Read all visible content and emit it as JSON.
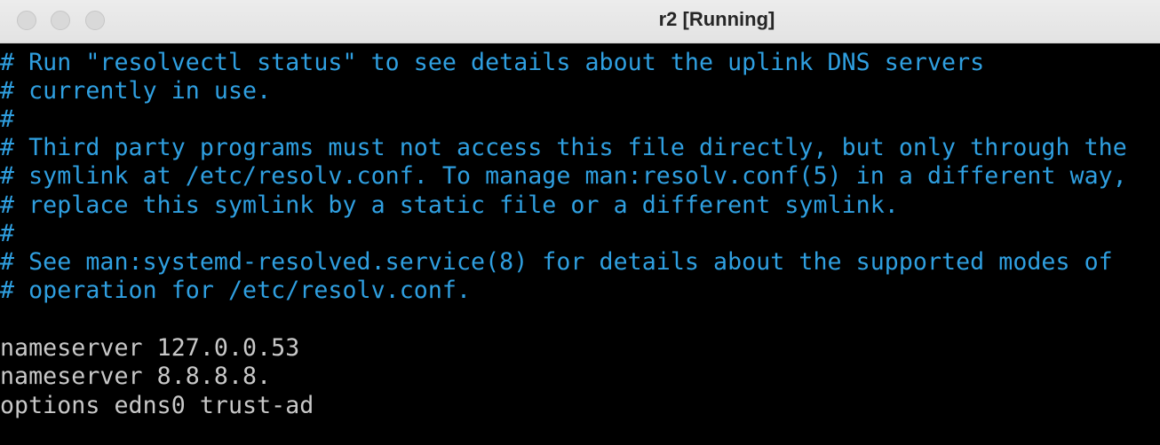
{
  "window": {
    "title": "r2 [Running]"
  },
  "terminal": {
    "lines": [
      {
        "text": "# Run \"resolvectl status\" to see details about the uplink DNS servers",
        "kind": "comment"
      },
      {
        "text": "# currently in use.",
        "kind": "comment"
      },
      {
        "text": "#",
        "kind": "comment"
      },
      {
        "text": "# Third party programs must not access this file directly, but only through the",
        "kind": "comment"
      },
      {
        "text": "# symlink at /etc/resolv.conf. To manage man:resolv.conf(5) in a different way,",
        "kind": "comment"
      },
      {
        "text": "# replace this symlink by a static file or a different symlink.",
        "kind": "comment"
      },
      {
        "text": "#",
        "kind": "comment"
      },
      {
        "text": "# See man:systemd-resolved.service(8) for details about the supported modes of",
        "kind": "comment"
      },
      {
        "text": "# operation for /etc/resolv.conf.",
        "kind": "comment"
      },
      {
        "text": "",
        "kind": "plain"
      },
      {
        "text": "nameserver 127.0.0.53",
        "kind": "plain"
      },
      {
        "text": "nameserver 8.8.8.8.",
        "kind": "plain"
      },
      {
        "text": "options edns0 trust-ad",
        "kind": "plain"
      }
    ]
  },
  "colors": {
    "comment": "#2f9fe0",
    "plain": "#c8c8c8",
    "background": "#000000"
  }
}
